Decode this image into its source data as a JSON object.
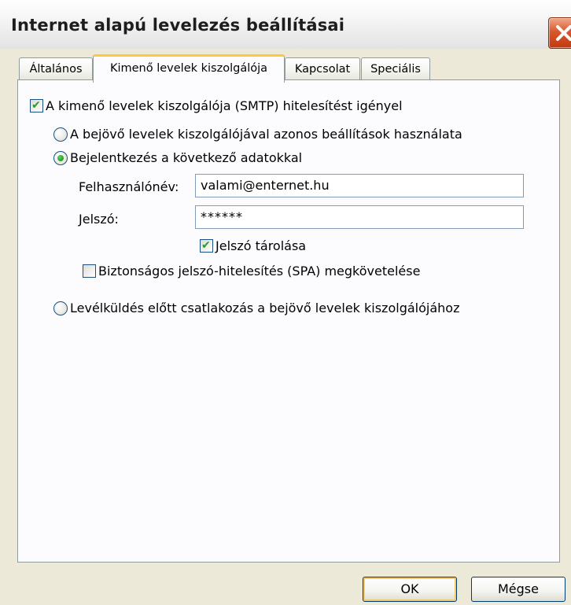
{
  "window": {
    "title": "Internet alapú levelezés beállításai"
  },
  "tabs": [
    {
      "label": "Általános",
      "active": false
    },
    {
      "label": "Kimenő levelek kiszolgálója",
      "active": true
    },
    {
      "label": "Kapcsolat",
      "active": false
    },
    {
      "label": "Speciális",
      "active": false
    }
  ],
  "form": {
    "smtp_auth": {
      "label": "A kimenő levelek kiszolgálója (SMTP) hitelesítést igényel",
      "checked": true
    },
    "same_settings": {
      "label": "A bejövő levelek kiszolgálójával azonos beállítások használata",
      "selected": false
    },
    "logon_with": {
      "label": "Bejelentkezés a következő adatokkal",
      "selected": true
    },
    "username": {
      "label": "Felhasználónév:",
      "value": "valami@enternet.hu"
    },
    "password": {
      "label": "Jelszó:",
      "value": "******"
    },
    "remember_password": {
      "label": "Jelszó tárolása",
      "checked": true
    },
    "spa": {
      "label": "Biztonságos jelszó-hitelesítés (SPA) megkövetelése",
      "checked": false
    },
    "logon_before_send": {
      "label": "Levélküldés előtt csatlakozás a bejövő levelek kiszolgálójához",
      "selected": false
    }
  },
  "buttons": {
    "ok": "OK",
    "cancel": "Mégse"
  },
  "icons": {
    "close": "close-icon",
    "check": "check-icon",
    "radio_dot": "radio-dot-icon"
  },
  "colors": {
    "active_tab_accent": "#ffc83c",
    "check_green": "#21a121",
    "close_red": "#d9582c"
  }
}
